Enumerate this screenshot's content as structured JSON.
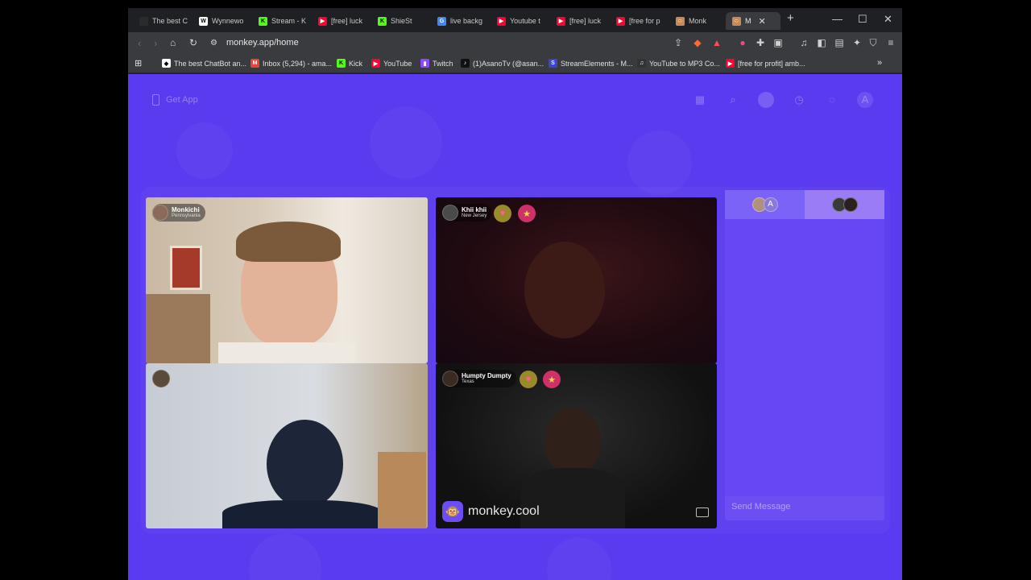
{
  "browser": {
    "tabs": [
      {
        "label": "The best C",
        "fav_color": "#2b2b2b"
      },
      {
        "label": "Wynnewo",
        "fav_color": "#ffffff"
      },
      {
        "label": "Stream - K",
        "fav_color": "#53fc18"
      },
      {
        "label": "[free] luck",
        "fav_color": "#ff0033"
      },
      {
        "label": "ShieSt",
        "fav_color": "#53fc18"
      },
      {
        "label": "live backg",
        "fav_color": "#4285f4"
      },
      {
        "label": "Youtube t",
        "fav_color": "#ff0033"
      },
      {
        "label": "[free] luck",
        "fav_color": "#ff0033"
      },
      {
        "label": "[free for p",
        "fav_color": "#ff0033"
      },
      {
        "label": "Monk",
        "fav_color": "#c98a5b"
      },
      {
        "label": "M",
        "fav_color": "#c98a5b"
      }
    ],
    "new_tab": "+",
    "url": "monkey.app/home",
    "bookmarks": [
      {
        "label": "The best ChatBot an...",
        "color": "#ffffff"
      },
      {
        "label": "Inbox (5,294) - ama...",
        "color": "#ea4335"
      },
      {
        "label": "Kick",
        "color": "#53fc18"
      },
      {
        "label": "YouTube",
        "color": "#ff0033"
      },
      {
        "label": "Twitch",
        "color": "#9146ff"
      },
      {
        "label": "(1)AsanoTv (@asan...",
        "color": "#111111"
      },
      {
        "label": "StreamElements - M...",
        "color": "#3c44d6"
      },
      {
        "label": "YouTube to MP3 Co...",
        "color": "#333333"
      },
      {
        "label": "[free for profit] amb...",
        "color": "#ff0033"
      }
    ],
    "overflow": "»"
  },
  "page": {
    "get_app": "Get App",
    "users": [
      {
        "name": "Monkichi",
        "location": "Pennsylvania"
      },
      {
        "name": "Khii khii",
        "location": "New Jersey"
      },
      {
        "name": "Humpty Dumpty",
        "location": "Texas"
      }
    ],
    "watermark": "monkey.cool",
    "chat": {
      "tab1_initial": "A",
      "send_placeholder": "Send Message"
    },
    "profile_initial": "A"
  },
  "colors": {
    "page_bg": "#5b3bef",
    "accent": "#6b4df5"
  }
}
